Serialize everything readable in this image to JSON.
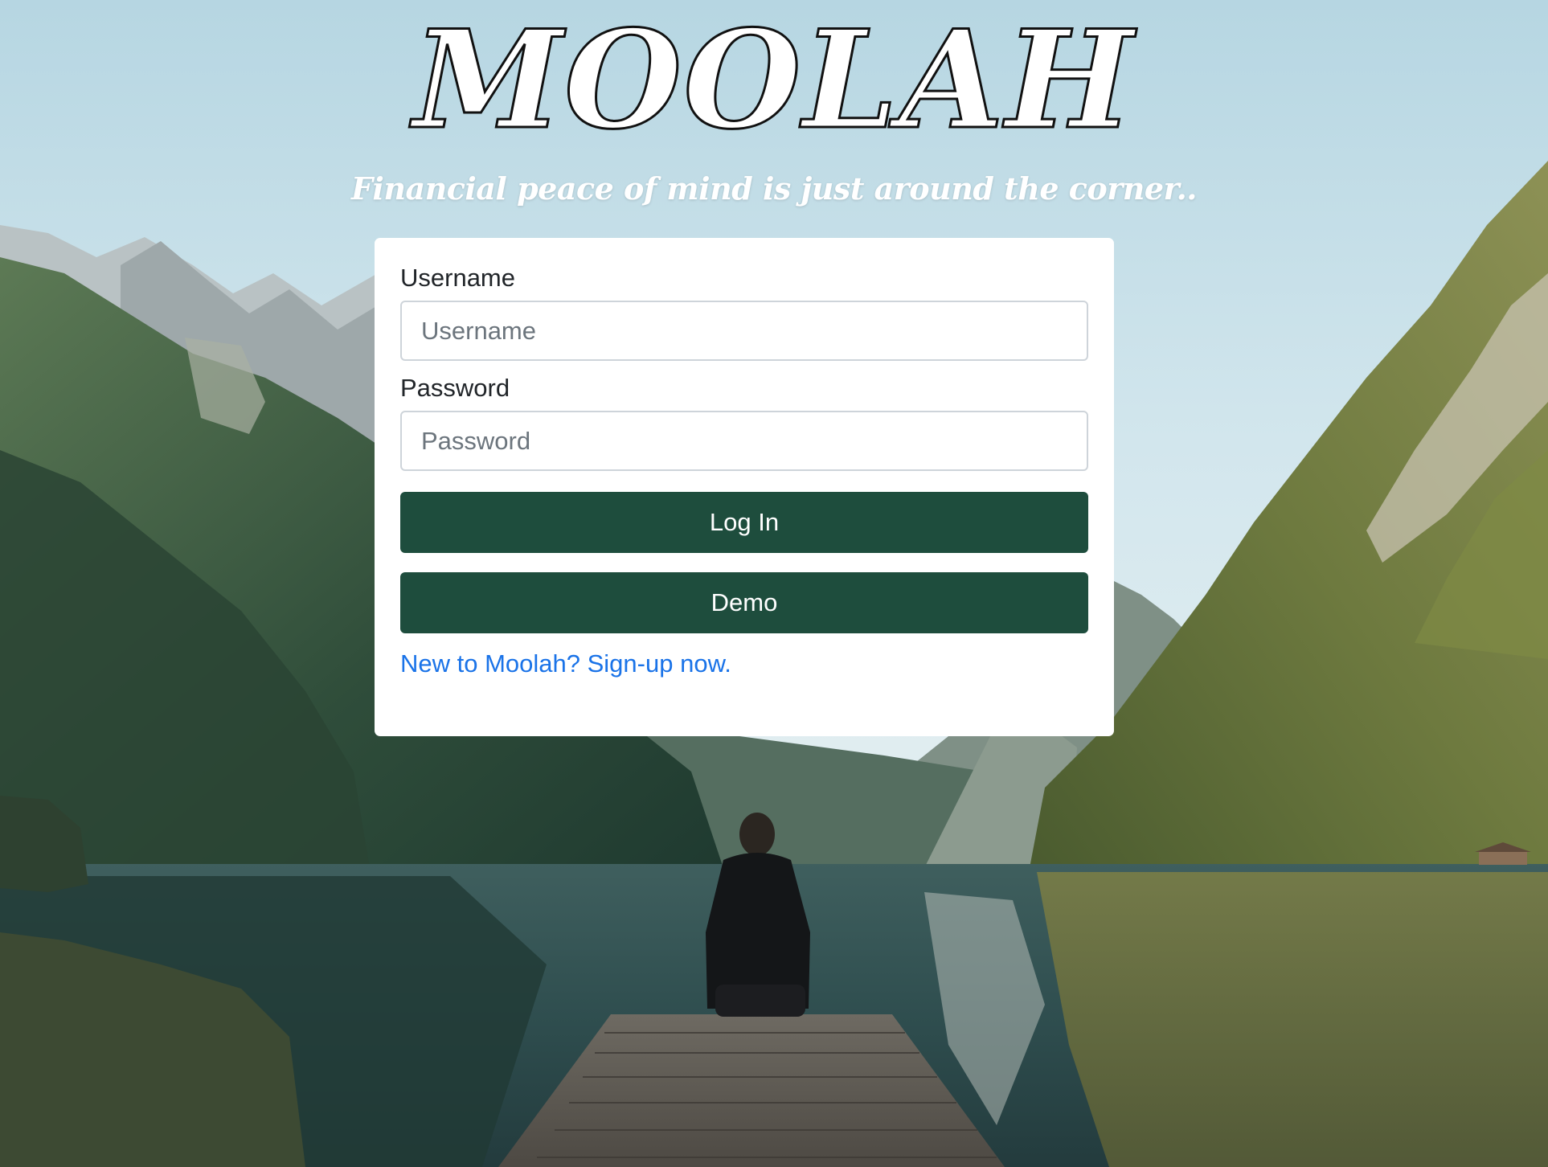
{
  "brand": {
    "logo_text": "MOOLAH",
    "tagline": "Financial peace of mind is just around the corner.."
  },
  "login_form": {
    "username_label": "Username",
    "username_placeholder": "Username",
    "username_value": "",
    "password_label": "Password",
    "password_placeholder": "Password",
    "password_value": "",
    "login_button": "Log In",
    "demo_button": "Demo",
    "signup_link": "New to Moolah? Sign-up now."
  },
  "colors": {
    "button_bg": "#1e4d3d",
    "link": "#1a73e8",
    "card_bg": "#ffffff"
  }
}
